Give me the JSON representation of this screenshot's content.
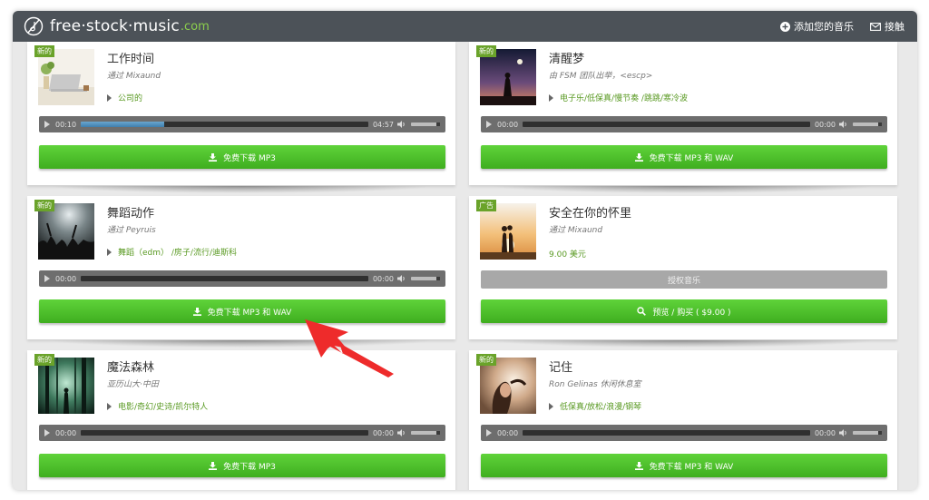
{
  "header": {
    "logo_main": "free·stock·music",
    "logo_domain": ".com",
    "nav_add": "添加您的音乐",
    "nav_contact": "接触",
    "colors": {
      "bar": "#4c5258",
      "accent": "#8ccf4d"
    }
  },
  "cards": [
    {
      "badge": "新的",
      "title": "工作时间",
      "by": "通过 Mixaund",
      "tags": "公司的",
      "player": {
        "current": "00:10",
        "duration": "04:57",
        "progress": 0.29
      },
      "button": "免费下载 MP3"
    },
    {
      "badge": "新的",
      "title": "清醒梦",
      "by": "由 FSM 团队出举，<escp>",
      "tags": "电子乐/低保真/慢节奏 /跳跳/寒冷波",
      "player": {
        "current": "00:00",
        "duration": "00:00",
        "progress": 0
      },
      "button": "免费下载 MP3 和 WAV"
    },
    {
      "badge": "新的",
      "title": "舞蹈动作",
      "by": "通过 Peyruis",
      "tags": "舞蹈（edm） /房子/流行/迪斯科",
      "player": {
        "current": "00:00",
        "duration": "00:00",
        "progress": 0
      },
      "button": "免费下载 MP3 和 WAV"
    },
    {
      "badge": "广告",
      "title": "安全在你的怀里",
      "by": "通过 Mixaund",
      "price": "9.00 美元",
      "license": "授权音乐",
      "button": "预览 / 购买 ( $9.00 )"
    },
    {
      "badge": "新的",
      "title": "魔法森林",
      "by": "亚历山大·中田",
      "tags": "电影/奇幻/史诗/凯尔特人",
      "player": {
        "current": "00:00",
        "duration": "00:00",
        "progress": 0
      },
      "button": "免费下载 MP3"
    },
    {
      "badge": "新的",
      "title": "记住",
      "by": "Ron Gelinas 休闲休息室",
      "tags": "低保真/放松/浪漫/钢琴",
      "player": {
        "current": "00:00",
        "duration": "00:00",
        "progress": 0
      },
      "button": "免费下载 MP3 和 WAV"
    }
  ]
}
